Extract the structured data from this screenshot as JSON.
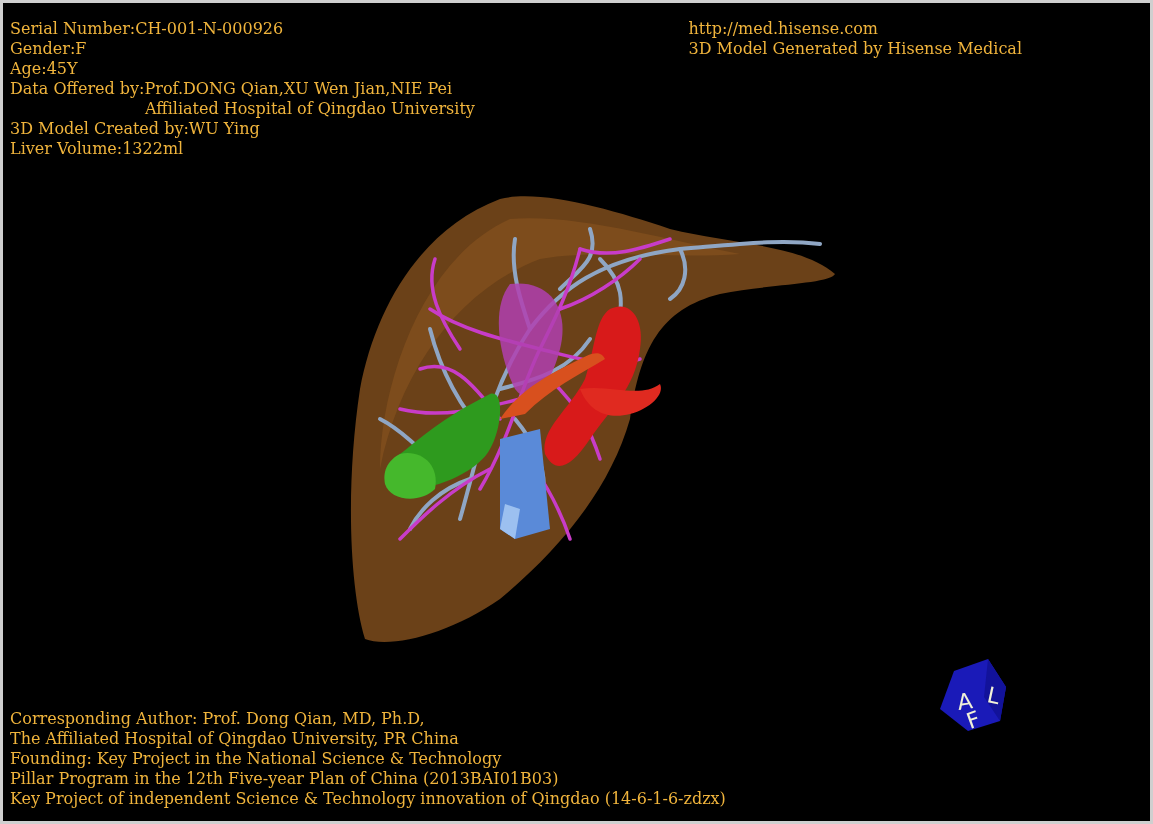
{
  "info": [
    {
      "kind": "line",
      "text": "Serial Number:CH-001-N-000926"
    },
    {
      "kind": "line",
      "text": "Gender:F"
    },
    {
      "kind": "line",
      "text": "Age:45Y"
    },
    {
      "kind": "line",
      "text": "Data Offered by:Prof.DONG Qian,XU Wen Jian,NIE Pei"
    },
    {
      "kind": "indented",
      "text": "Affiliated Hospital of Qingdao University"
    },
    {
      "kind": "line",
      "text": "3D Model Created by:WU Ying"
    },
    {
      "kind": "line",
      "text": "Liver Volume:1322ml"
    }
  ],
  "site": [
    "http://med.hisense.com",
    "3D Model Generated by Hisense Medical"
  ],
  "credits": [
    "Corresponding Author: Prof. Dong Qian, MD, Ph.D,",
    "The Affiliated Hospital of Qingdao University, PR China",
    "Founding: Key Project in the National Science & Technology",
    "Pillar Program in the 12th Five-year Plan of China (2013BAI01B03)",
    "Key Project of independent Science & Technology innovation of Qingdao (14-6-1-6-zdzx)"
  ],
  "orientation_cube": {
    "faces": [
      "A",
      "L",
      "F"
    ]
  }
}
